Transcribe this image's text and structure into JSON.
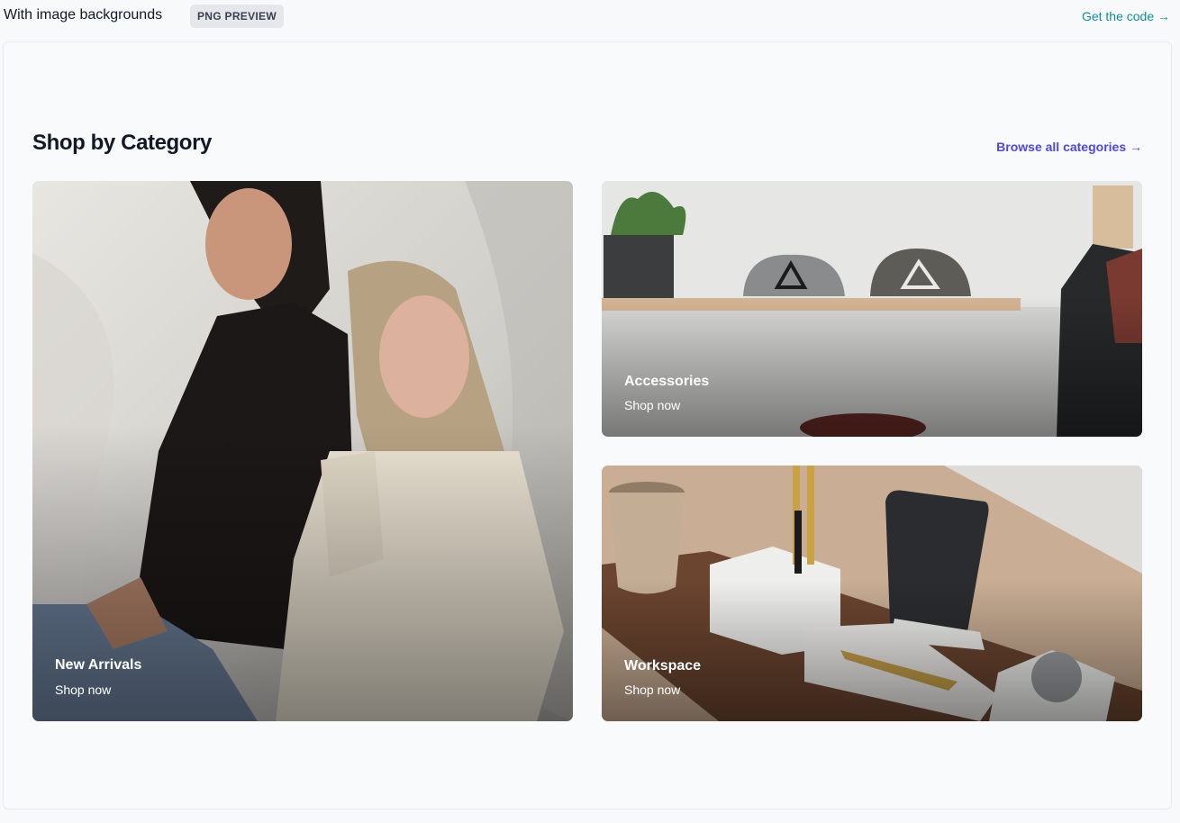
{
  "header": {
    "title": "With image backgrounds",
    "badge": "PNG PREVIEW",
    "code_link": "Get the code →"
  },
  "section": {
    "heading": "Shop by Category",
    "browse_link": "Browse all categories →"
  },
  "categories": [
    {
      "name": "New Arrivals",
      "cta": "Shop now"
    },
    {
      "name": "Accessories",
      "cta": "Shop now"
    },
    {
      "name": "Workspace",
      "cta": "Shop now"
    }
  ],
  "colors": {
    "accent_link": "#4f46e5",
    "code_link": "#0e8f9a",
    "heading": "#111827"
  }
}
